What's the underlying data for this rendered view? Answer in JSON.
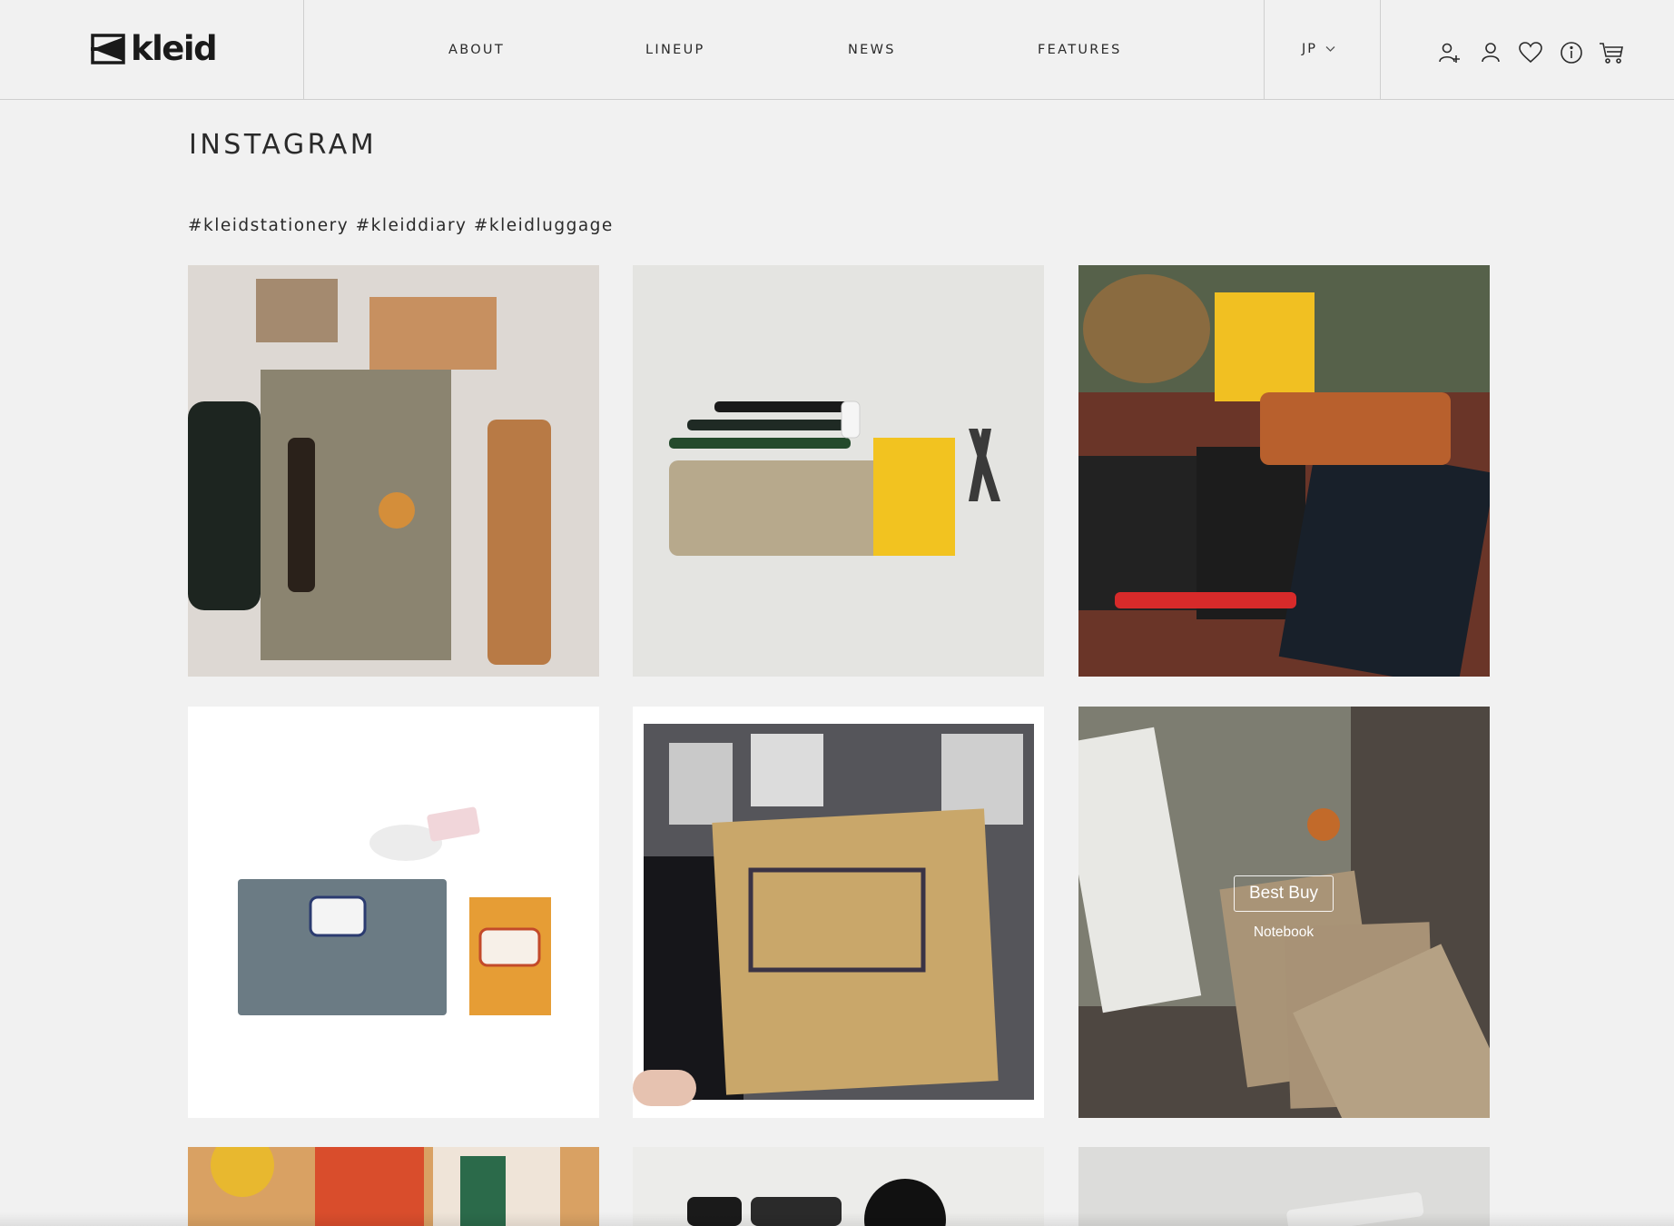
{
  "brand": {
    "name": "kleid"
  },
  "nav": {
    "items": [
      {
        "label": "ABOUT"
      },
      {
        "label": "LINEUP"
      },
      {
        "label": "NEWS"
      },
      {
        "label": "FEATURES"
      }
    ],
    "language": "JP"
  },
  "header_icons": [
    "add-user-icon",
    "user-icon",
    "heart-icon",
    "info-icon",
    "cart-icon"
  ],
  "page": {
    "title": "INSTAGRAM",
    "hashtags": "#kleidstationery #kleiddiary #kleidluggage"
  },
  "hover_overlay": {
    "label": "Best Buy",
    "sublabel": "Notebook"
  },
  "colors": {
    "background": "#f1f1f1",
    "divider": "#cfcfcf",
    "text": "#2a2a2a"
  }
}
